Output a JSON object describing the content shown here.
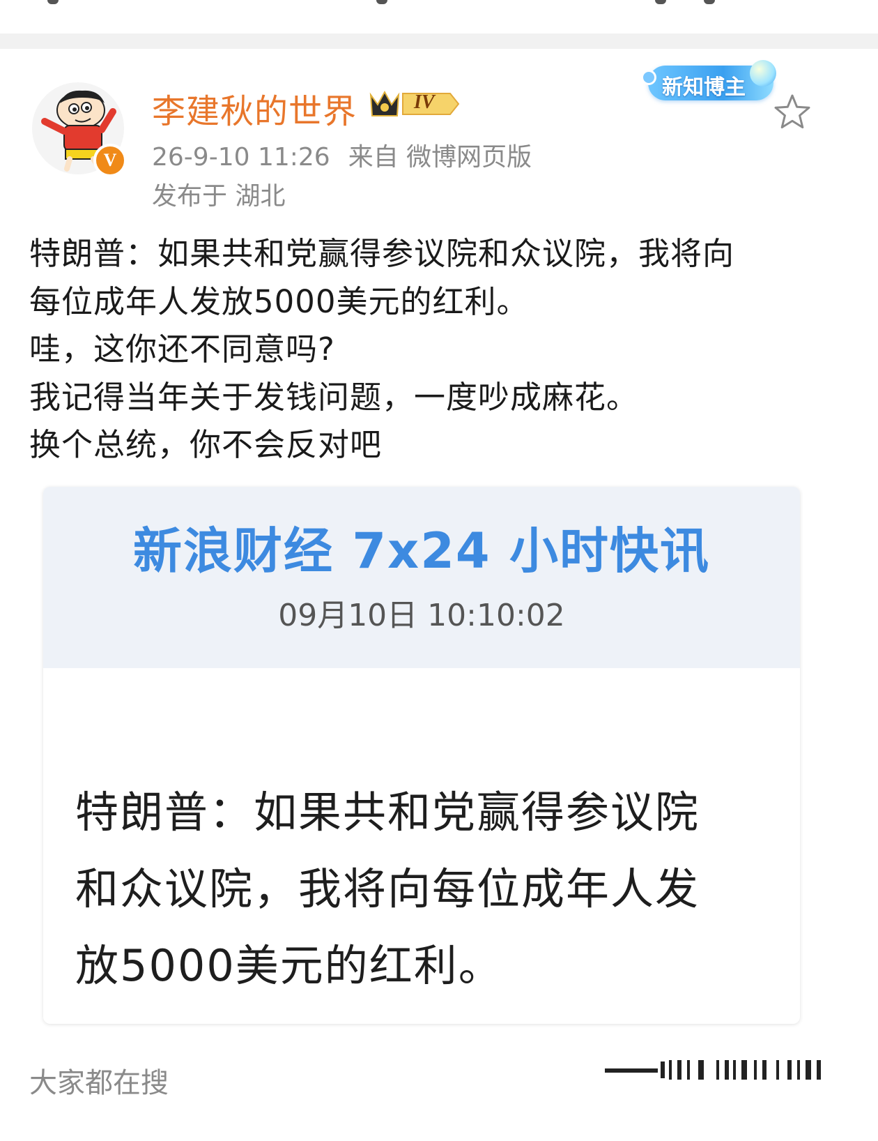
{
  "post": {
    "username": "李建秋的世界",
    "level": "IV",
    "datetime": "26-9-10 11:26",
    "source": "来自 微博网页版",
    "location": "发布于 湖北",
    "badge": "新知博主",
    "verified_mark": "V",
    "text_lines": [
      "特朗普：如果共和党赢得参议院和众议院，我将向",
      "每位成年人发放5000美元的红利。",
      "哇，这你还不同意吗?",
      "我记得当年关于发钱问题，一度吵成麻花。",
      "换个总统，你不会反对吧"
    ]
  },
  "card": {
    "title": "新浪财经 7x24 小时快讯",
    "time": "09月10日 10:10:02",
    "body_lines": [
      "特朗普：如果共和党赢得参议院",
      "和众议院，我将向每位成年人发",
      "放5000美元的红利。"
    ]
  },
  "footer": {
    "search_label": "大家都在搜"
  },
  "icons": {
    "avatar": "cartoon-avatar-icon",
    "crown": "crown-icon",
    "favorite": "star-outline-icon"
  },
  "colors": {
    "username": "#e8762b",
    "card_title": "#3d8ae0",
    "meta": "#8a8a8a",
    "verified": "#f08a18"
  }
}
